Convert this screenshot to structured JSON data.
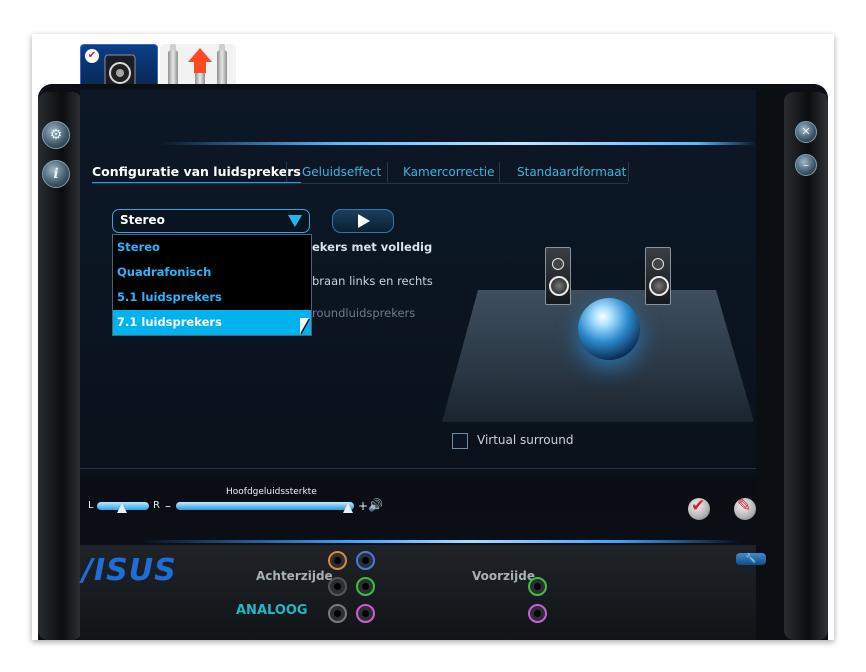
{
  "device_tabs": {
    "speakers": {
      "icon": "speaker-device-icon",
      "check": "✔"
    },
    "jack": {
      "icon": "rca-plug-icon"
    }
  },
  "side": {
    "settings_icon": "gear-icon",
    "info_label": "i",
    "close_label": "✕",
    "minimize_label": "–"
  },
  "tabs": [
    {
      "label": "Configuratie van luidsprekers",
      "active": true
    },
    {
      "label": "Geluidseffect"
    },
    {
      "label": "Kamercorrectie"
    },
    {
      "label": "Standaardformaat"
    }
  ],
  "speaker_config": {
    "selected": "Stereo",
    "options": [
      "Stereo",
      "Quadrafonisch",
      "5.1 luidsprekers",
      "7.1 luidsprekers"
    ],
    "highlighted_index": 3
  },
  "partial_text": {
    "line1": "ekers met volledig",
    "line2": "braan links en rechts",
    "line3": "roundluidsprekers"
  },
  "virtual_surround": {
    "label": "Virtual surround",
    "checked": false
  },
  "volume": {
    "balance_left": "L",
    "balance_right": "R",
    "label": "Hoofdgeluidssterkte",
    "minus": "–",
    "plus": "+",
    "speaker_icon": "🔊"
  },
  "actions": {
    "ok": "✔",
    "edit": "✎"
  },
  "footer": {
    "brand": "/ISUS",
    "back_label": "Achterzijde",
    "front_label": "Voorzijde",
    "analog_label": "ANALOOG",
    "wrench_label": "🔧",
    "jacks_back": [
      {
        "name": "orange-jack",
        "color": "#d98a3a"
      },
      {
        "name": "blue-jack",
        "color": "#4a7ad8"
      },
      {
        "name": "black-jack",
        "color": "#2b2b2b"
      },
      {
        "name": "green-jack",
        "color": "#3fbf3f"
      },
      {
        "name": "gray-jack",
        "color": "#7a7a7a"
      },
      {
        "name": "pink-jack",
        "color": "#d15bd4"
      }
    ],
    "jacks_front": [
      {
        "name": "green-jack",
        "color": "#3fbf3f"
      },
      {
        "name": "pink-jack",
        "color": "#d15bd4"
      }
    ]
  },
  "colors": {
    "accent": "#00b3ee",
    "tab_text": "#3fb4d8",
    "background": "#0b0e12"
  }
}
